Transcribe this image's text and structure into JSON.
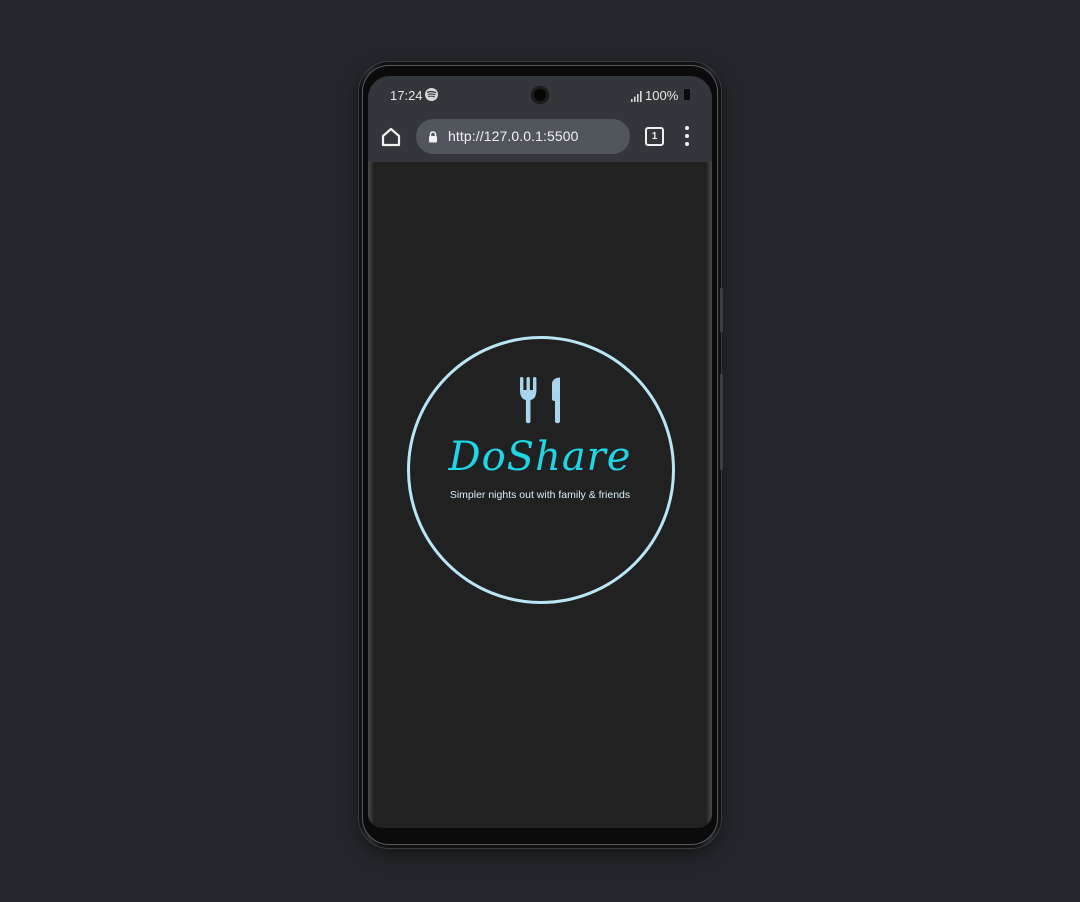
{
  "status_bar": {
    "time": "17:24",
    "battery": "100%"
  },
  "browser": {
    "url": "http://127.0.0.1:5500",
    "tab_count": "1"
  },
  "page": {
    "brand_name": "DoShare",
    "tagline": "Simpler nights out with family & friends"
  },
  "icons": {
    "status": [
      "spotify-icon",
      "signal-icon",
      "battery-icon"
    ],
    "toolbar": [
      "home-icon",
      "lock-icon",
      "tabs-icon",
      "more-vert-icon"
    ],
    "logo": "cutlery-icon"
  },
  "colors": {
    "background": "#23272b",
    "browser_chrome": "#33373b",
    "url_bar": "#50565c",
    "page_background": "#212121",
    "circle_border": "#b8e6f5",
    "brand_text": "#1fd6e6",
    "icon_light_blue": "#a9d4ee"
  }
}
